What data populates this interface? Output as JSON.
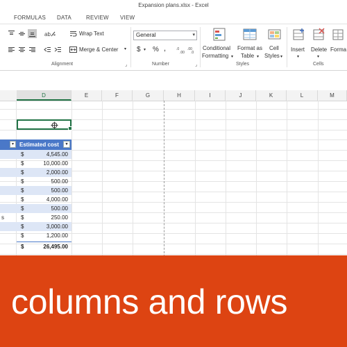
{
  "window": {
    "title": "Expansion plans.xlsx - Excel"
  },
  "ribbon_tabs": [
    "FORMULAS",
    "DATA",
    "REVIEW",
    "VIEW"
  ],
  "ribbon": {
    "wrap_text": "Wrap Text",
    "merge_center": "Merge & Center",
    "number_format": "General",
    "currency_symbol": "$",
    "percent_symbol": "%",
    "comma_symbol": ",",
    "conditional": [
      "Conditional",
      "Formatting"
    ],
    "format_as": [
      "Format as",
      "Table"
    ],
    "cell_styles": [
      "Cell",
      "Styles"
    ],
    "insert": "Insert",
    "delete": "Delete",
    "format": "Forma",
    "groups": {
      "alignment": "Alignment",
      "number": "Number",
      "styles": "Styles",
      "cells": "Cells"
    }
  },
  "sheet": {
    "columns": [
      "D",
      "E",
      "F",
      "G",
      "H",
      "I",
      "J",
      "K",
      "L",
      "M"
    ],
    "active_column": "D",
    "table_header": "Estimated cost",
    "currency": "$",
    "costs": [
      "4,545.00",
      "10,000.00",
      "2,000.00",
      "500.00",
      "500.00",
      "4,000.00",
      "500.00",
      "250.00",
      "3,000.00",
      "1,200.00"
    ],
    "total": "26,495.00",
    "edge_text": "s"
  },
  "caption": "columns and rows",
  "colors": {
    "excel_green": "#217346",
    "table_blue": "#4a78c8",
    "banner": "#dd4412"
  }
}
